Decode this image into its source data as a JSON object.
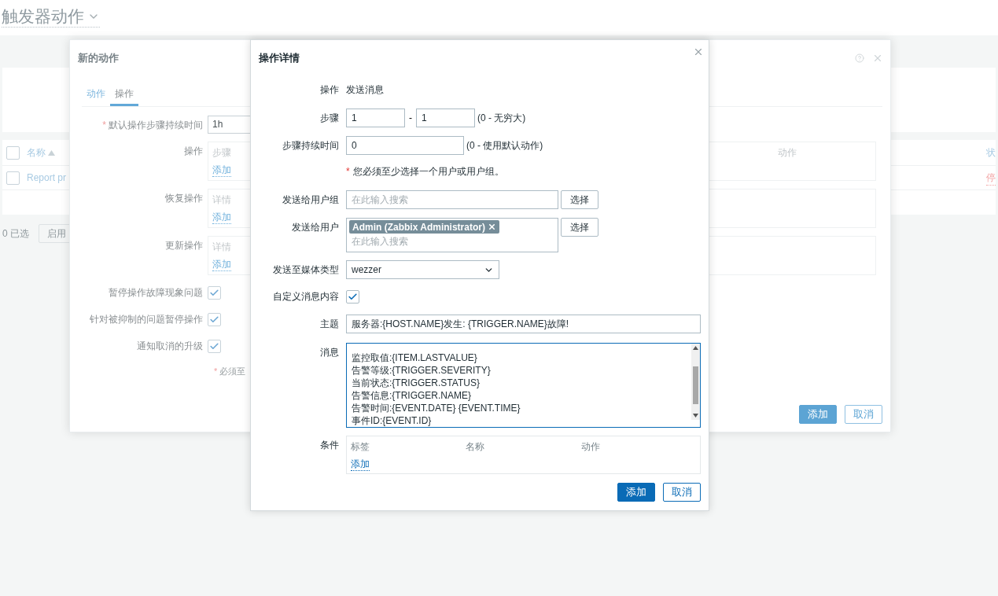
{
  "page": {
    "title": "触发器动作",
    "table": {
      "all_selected": false,
      "columns": [
        {
          "label": "名称",
          "sorted": true
        },
        {
          "label": "状"
        }
      ],
      "rows": [
        {
          "name": "Report pr",
          "status": "停",
          "selected": false
        }
      ]
    },
    "selected_count": "0 已选",
    "buttons": [
      "启用"
    ]
  },
  "action_dialog": {
    "title": "新的动作",
    "tabs": [
      {
        "label": "动作",
        "selected": false
      },
      {
        "label": "操作",
        "selected": true
      }
    ],
    "duration": {
      "label": "默认操作步骤持续时间",
      "required": true,
      "value": "1h"
    },
    "operation_blocks": [
      {
        "label": "操作",
        "column": "步骤",
        "right_column": "动作",
        "link": "添加"
      },
      {
        "label": "恢复操作",
        "column": "详情",
        "link": "添加"
      },
      {
        "label": "更新操作",
        "column": "详情",
        "link": "添加"
      }
    ],
    "checkboxes": [
      {
        "label": "暂停操作故障现象问题",
        "checked": true
      },
      {
        "label": "针对被抑制的问题暂停操作",
        "checked": true
      },
      {
        "label": "通知取消的升级",
        "checked": true
      }
    ],
    "note": {
      "mark": "*",
      "text": "必须至"
    },
    "buttons": [
      {
        "label": "添加",
        "kind": "primary"
      },
      {
        "label": "取消",
        "kind": "secondary"
      }
    ]
  },
  "operation_dialog": {
    "title": "操作详情",
    "operation": {
      "label": "操作",
      "value": "发送消息"
    },
    "steps": {
      "label": "步骤",
      "from": "1",
      "separator": "-",
      "to": "1",
      "hint": "(0 - 无穷大)"
    },
    "step_duration": {
      "label": "步骤持续时间",
      "value": "0",
      "hint": "(0 - 使用默认动作)"
    },
    "note": {
      "mark": "*",
      "text": "您必须至少选择一个用户或用户组。"
    },
    "user_groups": {
      "label": "发送给用户组",
      "placeholder": "在此输入搜索",
      "button": "选择"
    },
    "users": {
      "label": "发送给用户",
      "tags": [
        "Admin (Zabbix Administrator)"
      ],
      "placeholder": "在此输入搜索",
      "button": "选择"
    },
    "media_type": {
      "label": "发送至媒体类型",
      "value": "wezzer"
    },
    "custom_message": {
      "label": "自定义消息内容",
      "checked": true
    },
    "subject": {
      "label": "主题",
      "value": "服务器:{HOST.NAME}发生: {TRIGGER.NAME}故障!"
    },
    "message": {
      "label": "消息",
      "lines": [
        "监控取值:{ITEM.LASTVALUE}",
        "告警等级:{TRIGGER.SEVERITY}",
        "当前状态:{TRIGGER.STATUS}",
        "告警信息:{TRIGGER.NAME}",
        "告警时间:{EVENT.DATE} {EVENT.TIME}",
        "事件ID:{EVENT.ID}"
      ]
    },
    "conditions": {
      "label": "条件",
      "columns": [
        "标签",
        "名称",
        "动作"
      ],
      "link": "添加"
    },
    "buttons": [
      {
        "label": "添加",
        "kind": "primary"
      },
      {
        "label": "取消",
        "kind": "secondary"
      }
    ]
  }
}
